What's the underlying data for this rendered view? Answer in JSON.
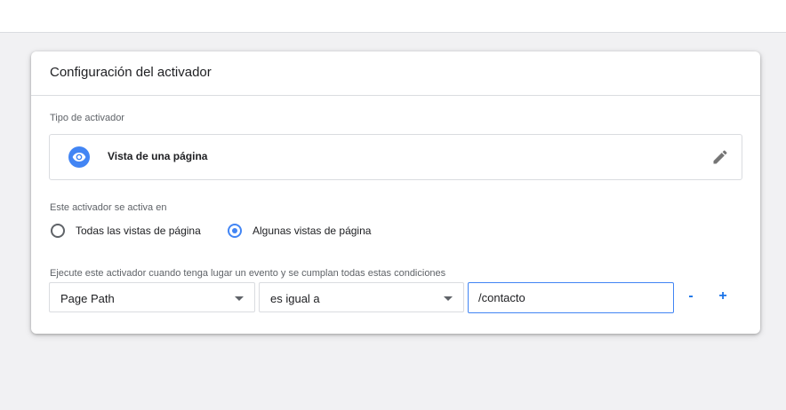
{
  "card": {
    "title": "Configuración del activador"
  },
  "trigger_type": {
    "label": "Tipo de activador",
    "name": "Vista de una página",
    "icon": "eye-icon",
    "edit_icon": "pencil-icon",
    "accent": "#4285f4"
  },
  "fires_on": {
    "label": "Este activador se activa en",
    "options": [
      {
        "label": "Todas las vistas de página",
        "selected": false
      },
      {
        "label": "Algunas vistas de página",
        "selected": true
      }
    ]
  },
  "conditions": {
    "label": "Ejecute este activador cuando tenga lugar un evento y se cumplan todas estas condiciones",
    "variable": "Page Path",
    "operator": "es igual a",
    "value": "/contacto",
    "remove_label": "-",
    "add_label": "+"
  }
}
